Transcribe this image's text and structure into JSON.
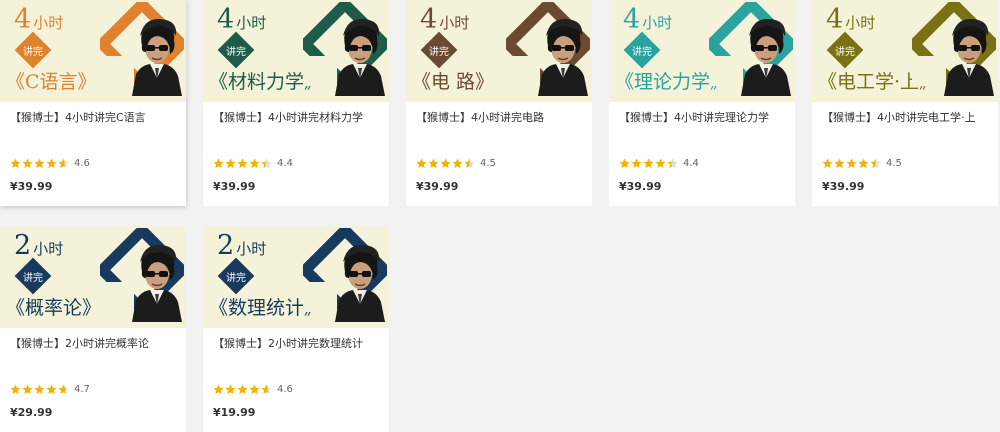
{
  "grid": {
    "courses": [
      {
        "hours": "4",
        "hours_unit": "小时",
        "jiangwan": "讲完",
        "subject": "《C语言》",
        "color": "#e0812e",
        "title": "【猴博士】4小时讲完C语言",
        "rating_value": "4.6",
        "stars": 4.6,
        "price": "¥39.99",
        "featured": true
      },
      {
        "hours": "4",
        "hours_unit": "小时",
        "jiangwan": "讲完",
        "subject": "《材料力学》",
        "color": "#1d5c4b",
        "title": "【猴博士】4小时讲完材料力学",
        "rating_value": "4.4",
        "stars": 4.4,
        "price": "¥39.99",
        "featured": false
      },
      {
        "hours": "4",
        "hours_unit": "小时",
        "jiangwan": "讲完",
        "subject": "《电 路》",
        "color": "#6b4a32",
        "title": "【猴博士】4小时讲完电路",
        "rating_value": "4.5",
        "stars": 4.5,
        "price": "¥39.99",
        "featured": false
      },
      {
        "hours": "4",
        "hours_unit": "小时",
        "jiangwan": "讲完",
        "subject": "《理论力学》",
        "color": "#2aa39e",
        "title": "【猴博士】4小时讲完理论力学",
        "rating_value": "4.4",
        "stars": 4.4,
        "price": "¥39.99",
        "featured": false
      },
      {
        "hours": "4",
        "hours_unit": "小时",
        "jiangwan": "讲完",
        "subject": "《电工学·上》",
        "color": "#7a7114",
        "title": "【猴博士】4小时讲完电工学·上",
        "rating_value": "4.5",
        "stars": 4.5,
        "price": "¥39.99",
        "featured": false
      },
      {
        "hours": "2",
        "hours_unit": "小时",
        "jiangwan": "讲完",
        "subject": "《概率论》",
        "color": "#173a5e",
        "title": "【猴博士】2小时讲完概率论",
        "rating_value": "4.7",
        "stars": 4.7,
        "price": "¥29.99",
        "featured": false
      },
      {
        "hours": "2",
        "hours_unit": "小时",
        "jiangwan": "讲完",
        "subject": "《数理统计》",
        "color": "#173a5e",
        "title": "【猴博士】2小时讲完数理统计",
        "rating_value": "4.6",
        "stars": 4.6,
        "price": "¥19.99",
        "featured": false
      }
    ]
  },
  "colors": {
    "star_filled": "#f5b301",
    "star_empty": "#dddddd",
    "banner_bg": "#f4f3d9",
    "page_bg": "#f2f2f2"
  },
  "icons": {
    "star": "star-icon",
    "portrait": "instructor-portrait"
  }
}
